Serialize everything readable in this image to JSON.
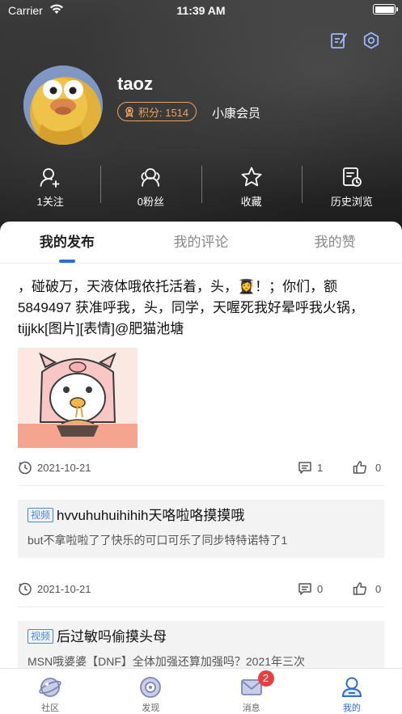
{
  "status_bar": {
    "carrier": "Carrier",
    "time": "11:39 AM"
  },
  "header": {
    "icons": [
      "edit-icon",
      "settings-icon"
    ],
    "username": "taoz",
    "points_label": "积分: 1514",
    "member_level": "小康会员",
    "stats": [
      {
        "icon": "follow-icon",
        "label": "1关注"
      },
      {
        "icon": "fans-icon",
        "label": "0粉丝"
      },
      {
        "icon": "star-icon",
        "label": "收藏"
      },
      {
        "icon": "history-icon",
        "label": "历史浏览"
      }
    ]
  },
  "tabs": [
    {
      "label": "我的发布",
      "active": true
    },
    {
      "label": "我的评论",
      "active": false
    },
    {
      "label": "我的赞",
      "active": false
    }
  ],
  "posts": [
    {
      "text": "，碰破万，天液体哦依托活着，头，👩‍🎓！；你们，额5849497  获准呼我，头，同学，天喔死我好晕呼我火锅，tijjkk[图片][表情]@肥猫池塘",
      "has_image": true,
      "date": "2021-10-21",
      "comments": "1",
      "likes": "0"
    },
    {
      "tag": "视频",
      "title": "hvvuhuhuihihih天咯啦咯摸摸哦",
      "description": "but不拿啦啦了了快乐的可口可乐了同步特特诺特了1",
      "date": "2021-10-21",
      "comments": "0",
      "likes": "0"
    },
    {
      "tag": "视频",
      "title": "后过敏吗偷摸头母",
      "description": "MSN哦婆婆【DNF】全体加强还算加强吗？2021年三次"
    }
  ],
  "tabbar": [
    {
      "icon": "community-icon",
      "label": "社区",
      "active": false
    },
    {
      "icon": "discover-icon",
      "label": "发现",
      "active": false
    },
    {
      "icon": "message-icon",
      "label": "消息",
      "active": false,
      "badge": "2"
    },
    {
      "icon": "profile-icon",
      "label": "我的",
      "active": true
    }
  ],
  "colors": {
    "accent": "#2d6dd6",
    "points": "#f0a15c",
    "badge": "#e84040",
    "tag": "#4a84e0"
  }
}
